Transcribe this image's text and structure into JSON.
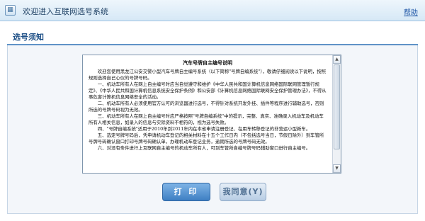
{
  "window": {
    "title": "欢迎进入互联网选号系统",
    "help_label": "帮助"
  },
  "section": {
    "title": "选号须知"
  },
  "notice": {
    "title": "汽车号牌自主编号说明",
    "paragraphs": [
      "欢迎您使用黑龙江公安交警小型汽车号牌自主编号系统（以下简称\"号牌自编系统\"），敬请仔细阅读以下说明，按照规则选择自己心仪的号牌号码。",
      "一、机动车所有人在网上自主编号时应当自觉遵守和维护《中华人民共和国计算机信息网络国际联网管理暂行规定》、《中华人民共和国计算机信息系统安全保护条例》和公安部《计算机信息网络国际联网安全保护管理办法》，不得从事危害计算机信息网络安全的活动。",
      "二、机动车所有人必须使用官方认可的浏览器进行选号，不得针对系统开发外挂、插件等程序进行辅助选号，否则所选的号牌号码视为无效。",
      "三、机动车所有人在网上自主编号时应严格按照\"号牌自编系统\"中的提示，完整、真实、准确录入机动车及机动车所有人相关信息，如录入的信息与实际资料不相符的，视为选号失败。",
      "四、\"号牌自编系统\"适用于2010年到2011年内在本省申请注册登记、在用车转移登记的非营运小型新车。",
      "五、选定号牌号码后，凭申请机动车登记的相关材料在十五个工作日内（不包括选号当日，节假日除外）到车管所号牌号码确认窗口打印号牌号码确认单，办理机动车登记业务，逾期所选的号牌号码无效。",
      "六、对没有条件进行上互联网自主编号的机动车所有人，可到车管所自编号牌号码辅助窗口进行自主编号。"
    ]
  },
  "buttons": {
    "print_label": "打 印",
    "back_label": "我同意(Y)"
  }
}
